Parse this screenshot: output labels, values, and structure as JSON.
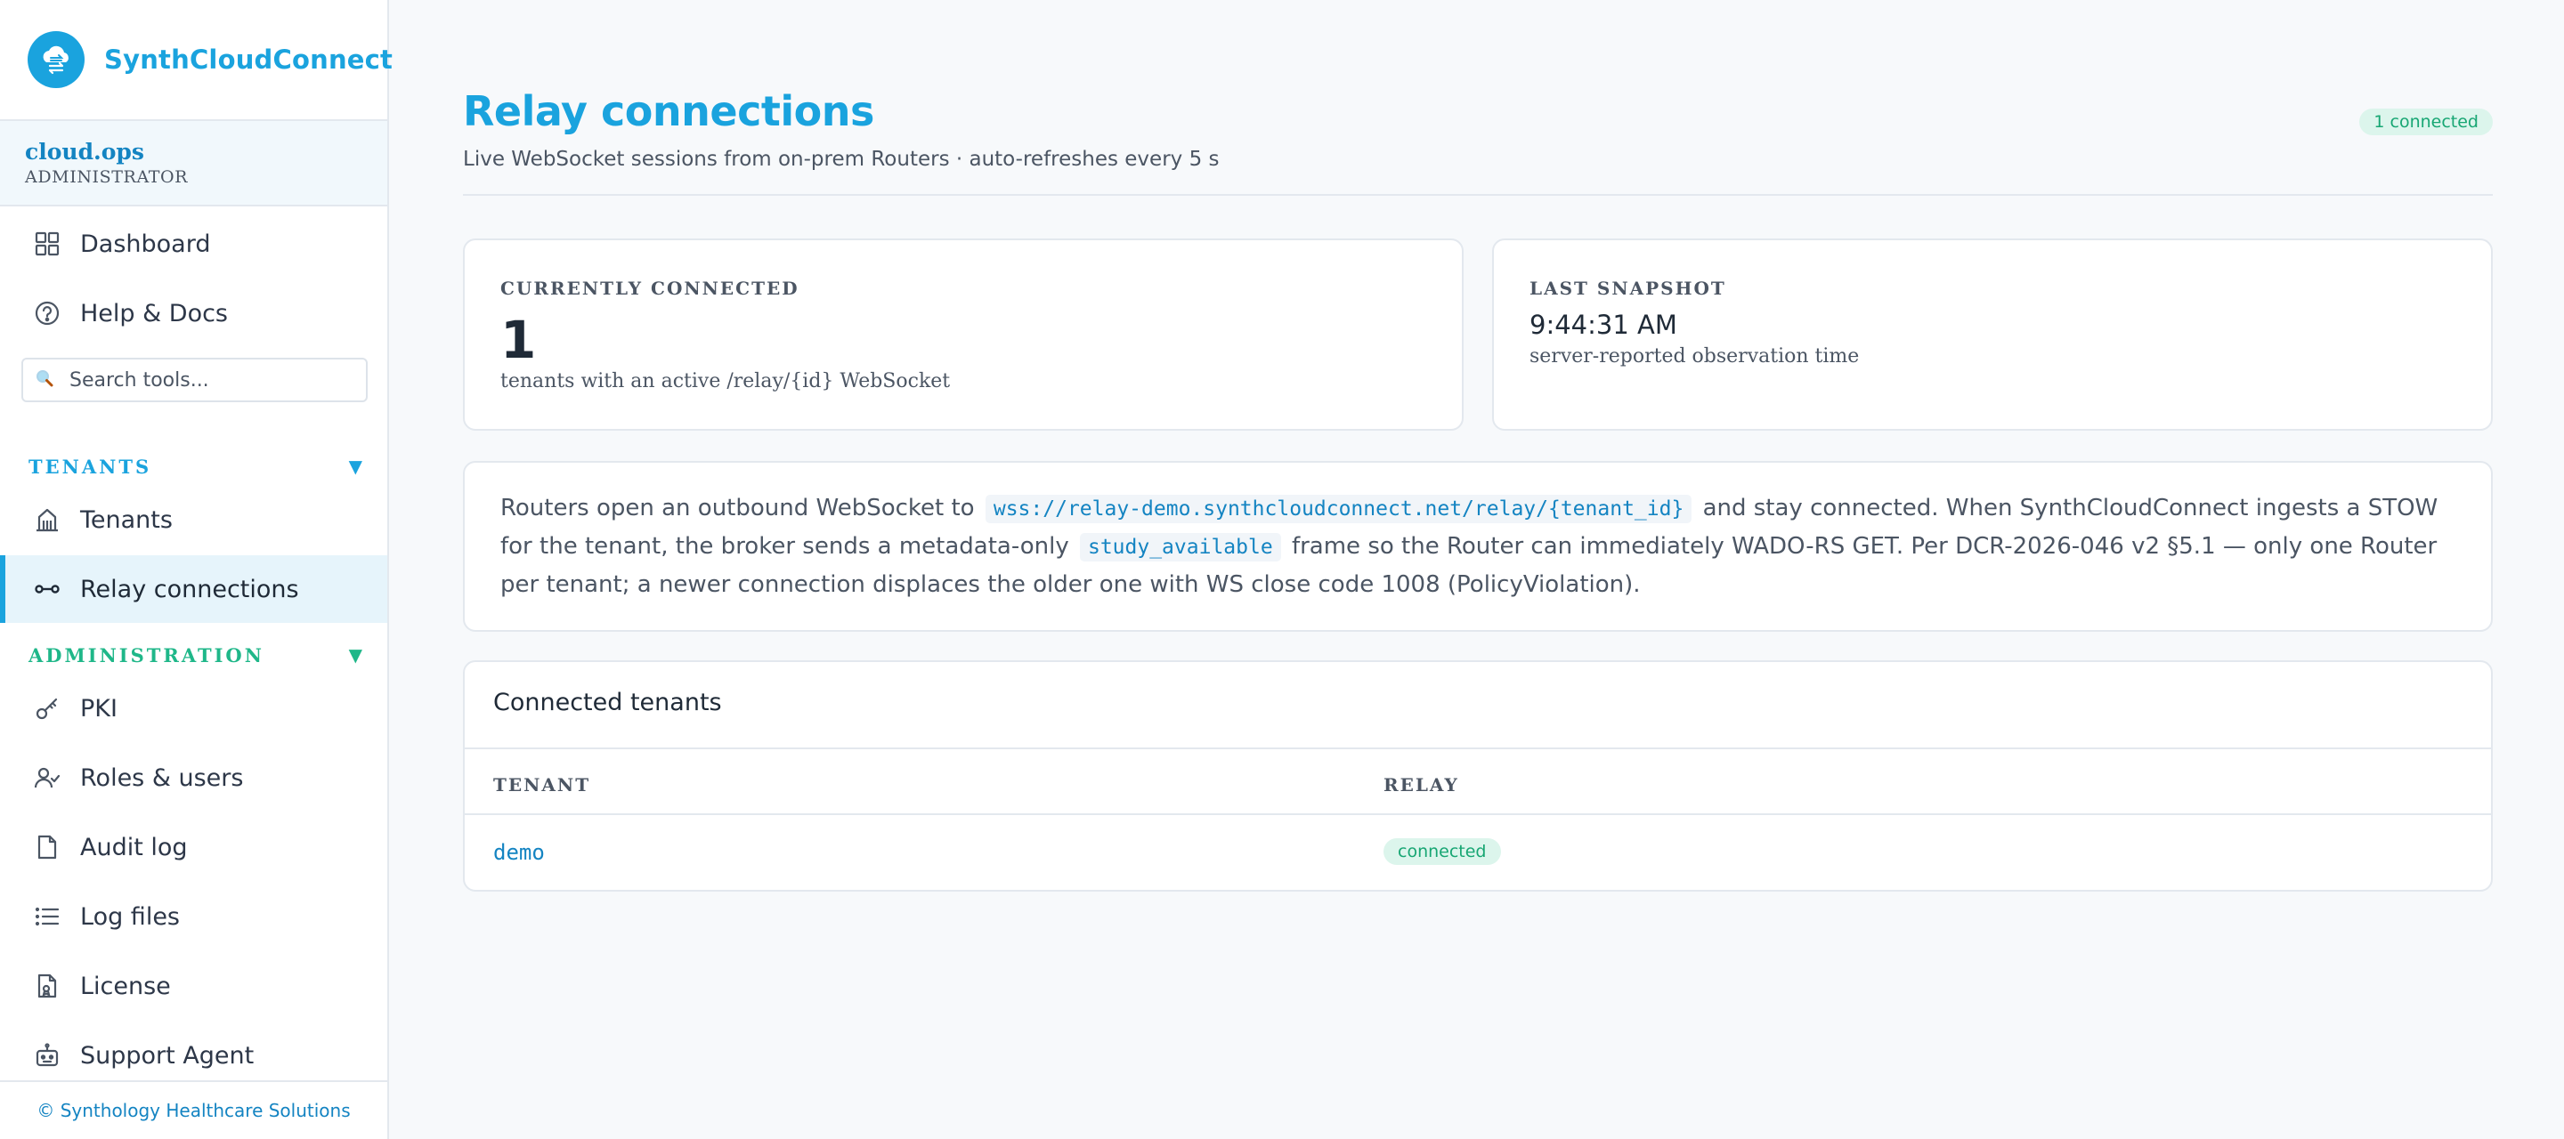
{
  "app": {
    "brand": "SynthCloudConnect",
    "footer": "© Synthology Healthcare Solutions"
  },
  "user": {
    "name": "cloud.ops",
    "role": "ADMINISTRATOR"
  },
  "sidebar": {
    "top_items": [
      {
        "label": "Dashboard",
        "icon": "grid-icon"
      },
      {
        "label": "Help & Docs",
        "icon": "help-icon"
      }
    ],
    "search": {
      "placeholder": "Search tools..."
    },
    "sections": [
      {
        "title": "TENANTS",
        "items": [
          {
            "label": "Tenants",
            "icon": "building-icon"
          },
          {
            "label": "Relay connections",
            "icon": "relay-icon",
            "active": true
          }
        ]
      },
      {
        "title": "ADMINISTRATION",
        "items": [
          {
            "label": "PKI",
            "icon": "key-icon"
          },
          {
            "label": "Roles & users",
            "icon": "user-check-icon"
          },
          {
            "label": "Audit log",
            "icon": "file-icon"
          },
          {
            "label": "Log files",
            "icon": "list-icon"
          },
          {
            "label": "License",
            "icon": "license-icon"
          },
          {
            "label": "Support Agent",
            "icon": "robot-icon"
          }
        ]
      }
    ]
  },
  "header": {
    "title": "Relay connections",
    "subtitle": "Live WebSocket sessions from on-prem Routers · auto-refreshes every 5 s",
    "badge": "1 connected"
  },
  "stats": {
    "connected": {
      "label": "CURRENTLY CONNECTED",
      "value": "1",
      "note": "tenants with an active /relay/{id} WebSocket"
    },
    "snapshot": {
      "label": "LAST SNAPSHOT",
      "value": "9:44:31 AM",
      "note": "server-reported observation time"
    }
  },
  "info": {
    "part1": "Routers open an outbound WebSocket to",
    "code1": "wss://relay-demo.synthcloudconnect.net/relay/{tenant_id}",
    "part2": "and stay connected. When SynthCloudConnect ingests a STOW for the tenant, the broker sends a metadata-only",
    "code2": "study_available",
    "part3": "frame so the Router can immediately WADO-RS GET. Per DCR-2026-046 v2 §5.1 — only one Router per tenant; a newer connection displaces the older one with WS close code 1008 (PolicyViolation)."
  },
  "table": {
    "title": "Connected tenants",
    "columns": [
      "TENANT",
      "RELAY"
    ],
    "rows": [
      {
        "tenant": "demo",
        "relay": "connected"
      }
    ]
  },
  "colors": {
    "accent": "#1aa3de",
    "success": "#17a673",
    "success_bg": "#dcf5ec"
  }
}
